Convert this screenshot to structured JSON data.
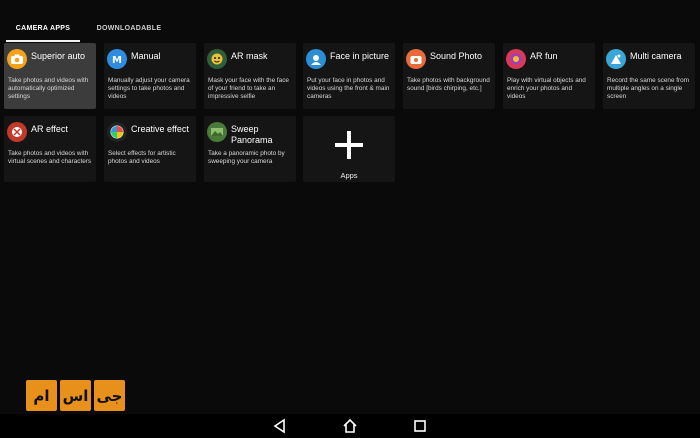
{
  "tabs": [
    {
      "label": "CAMERA APPS",
      "active": true
    },
    {
      "label": "DOWNLOADABLE",
      "active": false
    }
  ],
  "apps": [
    {
      "name": "Superior auto",
      "desc": "Take photos and videos with automatically optimized settings",
      "icon": "camera-icon",
      "color": "#f3a21b",
      "selected": true
    },
    {
      "name": "Manual",
      "desc": "Manually adjust your camera settings to take photos and videos",
      "icon": "manual-m-icon",
      "color": "#2e8de0",
      "selected": false
    },
    {
      "name": "AR mask",
      "desc": "Mask your face with the face of your friend to take an impressive selfie",
      "icon": "ar-mask-icon",
      "color": "#2f5e3a",
      "selected": false
    },
    {
      "name": "Face in picture",
      "desc": "Put your face in photos and videos using the front & main cameras",
      "icon": "face-in-picture-icon",
      "color": "#2a8fd6",
      "selected": false
    },
    {
      "name": "Sound Photo",
      "desc": "Take photos with background sound [birds chirping, etc.]",
      "icon": "sound-photo-icon",
      "color": "#e96a3a",
      "selected": false
    },
    {
      "name": "AR fun",
      "desc": "Play with virtual objects and enrich your photos and videos",
      "icon": "ar-fun-icon",
      "color": "#d93a5a",
      "selected": false
    },
    {
      "name": "Multi camera",
      "desc": "Record the same scene from multiple angles on a single screen",
      "icon": "multi-camera-icon",
      "color": "#3aa6d8",
      "selected": false
    },
    {
      "name": "AR effect",
      "desc": "Take photos and videos with virtual scenes and characters",
      "icon": "ar-effect-icon",
      "color": "#c0392b",
      "selected": false
    },
    {
      "name": "Creative effect",
      "desc": "Select effects for artistic photos and videos",
      "icon": "creative-effect-icon",
      "color": "#222222",
      "selected": false
    },
    {
      "name": "Sweep Panorama",
      "desc": "Take a panoramic photo by sweeping your camera",
      "icon": "panorama-icon",
      "color": "#4a7a3a",
      "selected": false
    }
  ],
  "add_tile": {
    "label": "Apps",
    "icon": "plus-icon"
  },
  "watermark": {
    "letters": [
      "جی",
      "اس",
      "ام"
    ],
    "color": "#e8901c"
  },
  "navbar": {
    "back": "back-icon",
    "home": "home-icon",
    "recents": "recents-icon"
  }
}
